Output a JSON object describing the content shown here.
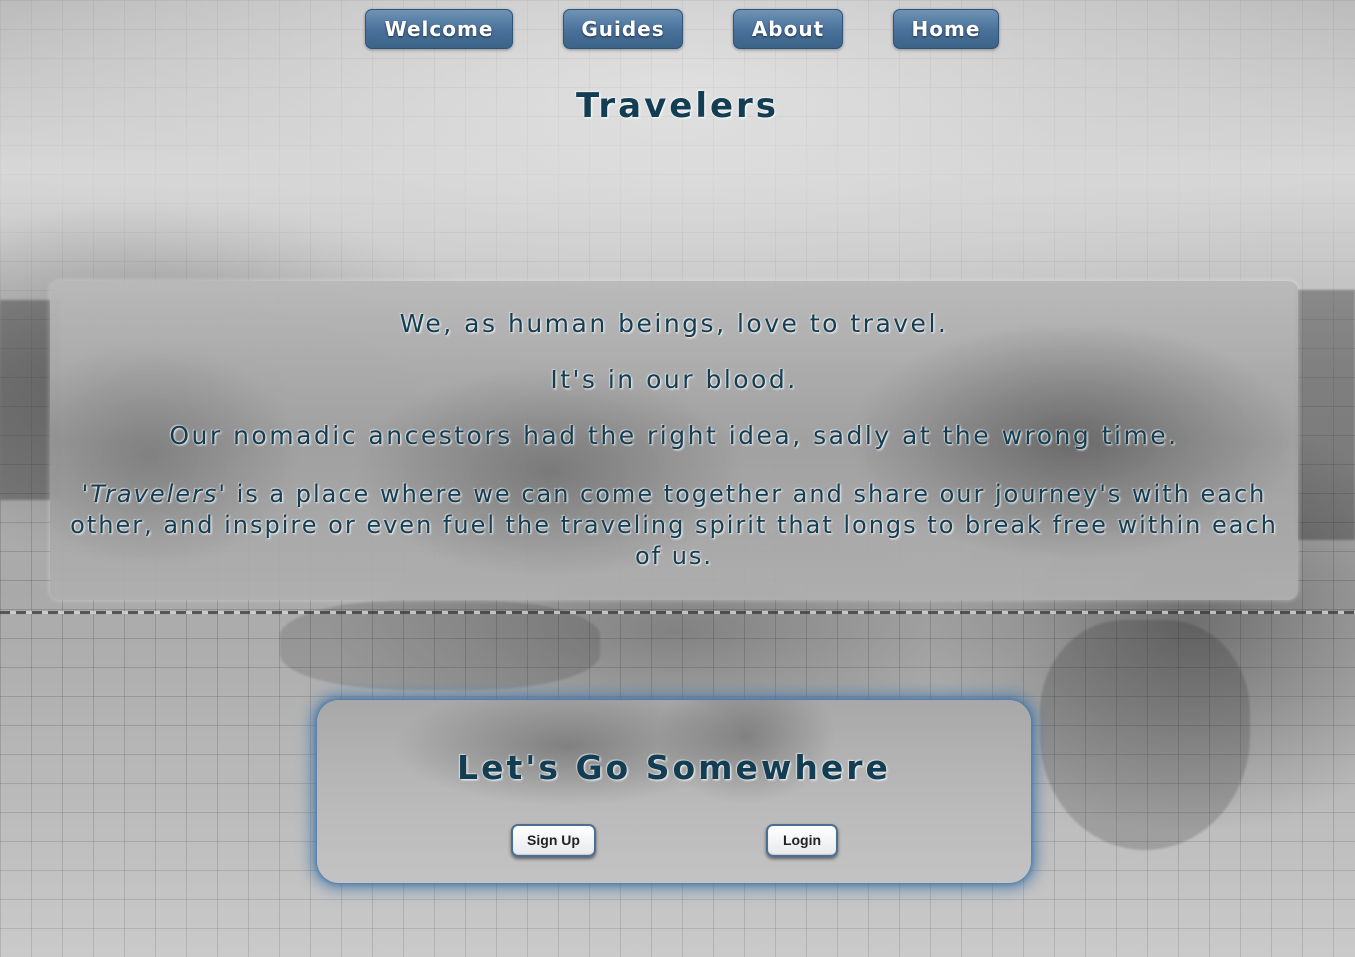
{
  "nav": {
    "items": [
      {
        "label": "Welcome"
      },
      {
        "label": "Guides"
      },
      {
        "label": "About"
      },
      {
        "label": "Home"
      }
    ]
  },
  "header": {
    "title": "Travelers"
  },
  "intro": {
    "line1": "We, as human beings, love to travel.",
    "line2": "It's in our blood.",
    "line3": "Our nomadic ancestors had the right idea, sadly at the wrong time.",
    "paragraph_emphasis": "'Travelers'",
    "paragraph_rest": " is a place where we can come together and share our journey's with each other, and inspire or even fuel the traveling spirit that longs to break free within each of us."
  },
  "cta": {
    "title": "Let's Go Somewhere",
    "signup_label": "Sign Up",
    "login_label": "Login"
  },
  "colors": {
    "nav_button": "#48709a",
    "heading_text": "#123d52",
    "cta_glow": "#4678aa"
  }
}
